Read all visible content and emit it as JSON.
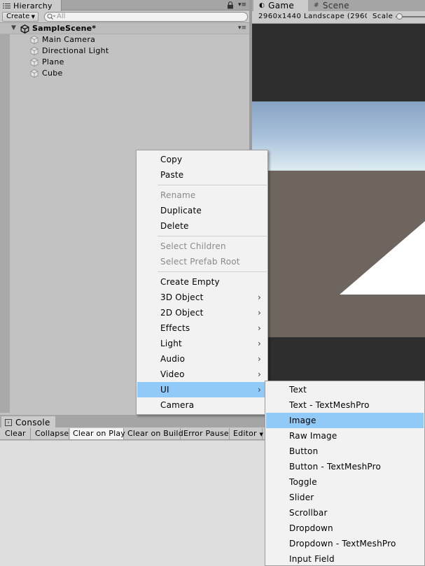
{
  "hierarchy": {
    "tab_label": "Hierarchy",
    "create_label": "Create",
    "search_placeholder": "All",
    "scene_name": "SampleScene*",
    "items": [
      "Main Camera",
      "Directional Light",
      "Plane",
      "Cube"
    ]
  },
  "game": {
    "tabs": [
      {
        "label": "Game",
        "icon": "game-icon"
      },
      {
        "label": "Scene",
        "icon": "scene-grid-icon"
      }
    ],
    "resolution": "2960x1440 Landscape (2960",
    "scale_label": "Scale"
  },
  "console": {
    "tab_label": "Console",
    "buttons": [
      "Clear",
      "Collapse",
      "Clear on Play",
      "Clear on Build",
      "Error Pause",
      "Editor"
    ],
    "active_button": "Clear on Play"
  },
  "context_menu": {
    "items": [
      {
        "label": "Copy",
        "enabled": true
      },
      {
        "label": "Paste",
        "enabled": true
      },
      {
        "label": "Rename",
        "enabled": false
      },
      {
        "label": "Duplicate",
        "enabled": true
      },
      {
        "label": "Delete",
        "enabled": true
      },
      {
        "label": "Select Children",
        "enabled": false
      },
      {
        "label": "Select Prefab Root",
        "enabled": false
      },
      {
        "label": "Create Empty",
        "enabled": true
      },
      {
        "label": "3D Object",
        "enabled": true,
        "submenu": true
      },
      {
        "label": "2D Object",
        "enabled": true,
        "submenu": true
      },
      {
        "label": "Effects",
        "enabled": true,
        "submenu": true
      },
      {
        "label": "Light",
        "enabled": true,
        "submenu": true
      },
      {
        "label": "Audio",
        "enabled": true,
        "submenu": true
      },
      {
        "label": "Video",
        "enabled": true,
        "submenu": true
      },
      {
        "label": "UI",
        "enabled": true,
        "submenu": true,
        "highlighted": true
      },
      {
        "label": "Camera",
        "enabled": true
      }
    ],
    "highlight_color": "#91c9f7"
  },
  "ui_submenu": {
    "items": [
      "Text",
      "Text - TextMeshPro",
      "Image",
      "Raw Image",
      "Button",
      "Button - TextMeshPro",
      "Toggle",
      "Slider",
      "Scrollbar",
      "Dropdown",
      "Dropdown - TextMeshPro",
      "Input Field"
    ],
    "highlighted": "Image"
  }
}
